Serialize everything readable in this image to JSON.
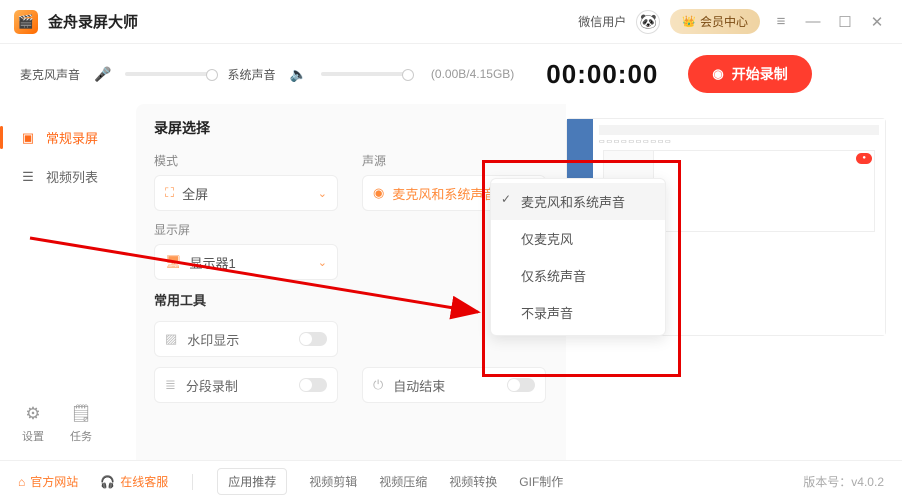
{
  "titlebar": {
    "app_name": "金舟录屏大师",
    "wechat_user": "微信用户",
    "vip_center": "会员中心"
  },
  "audiobar": {
    "mic_label": "麦克风声音",
    "sys_label": "系统声音",
    "storage": "(0.00B/4.15GB)",
    "timer": "00:00:00",
    "record": "开始录制"
  },
  "sidebar": {
    "items": [
      {
        "label": "常规录屏"
      },
      {
        "label": "视频列表"
      }
    ],
    "settings": "设置",
    "tasks": "任务"
  },
  "main": {
    "section_title": "录屏选择",
    "mode_label": "模式",
    "mode_value": "全屏",
    "source_label": "声源",
    "source_value": "麦克风和系统声音",
    "display_label": "显示屏",
    "display_value": "显示器1",
    "tools_title": "常用工具",
    "watermark": "水印显示",
    "segment": "分段录制",
    "autoend": "自动结束"
  },
  "dropdown": {
    "items": [
      "麦克风和系统声音",
      "仅麦克风",
      "仅系统声音",
      "不录声音"
    ]
  },
  "footer": {
    "website": "官方网站",
    "support": "在线客服",
    "recommend": "应用推荐",
    "edit": "视频剪辑",
    "compress": "视频压缩",
    "convert": "视频转换",
    "gif": "GIF制作",
    "version_label": "版本号：",
    "version_value": "v4.0.2"
  }
}
